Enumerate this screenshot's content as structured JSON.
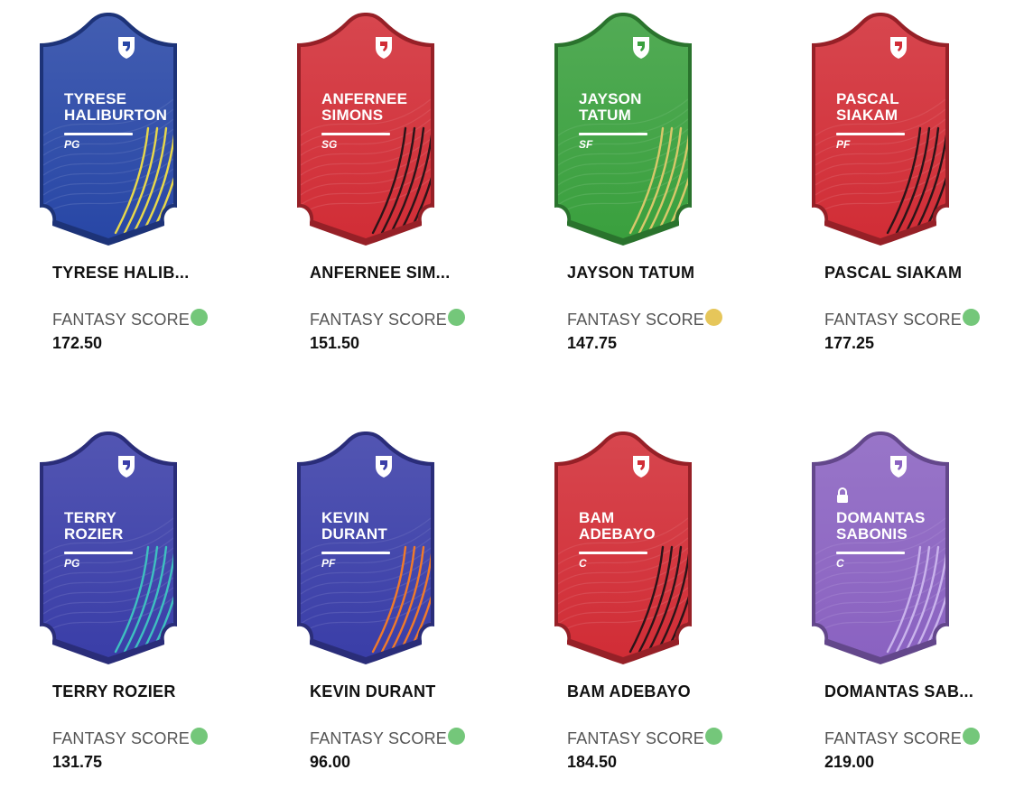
{
  "fantasy_label": "FANTASY SCORE",
  "colors": {
    "blue": "#2847a6",
    "red": "#d12d36",
    "green": "#3aa03e",
    "indigo": "#3a3ea8",
    "purple": "#8a62c1",
    "status_green": "#74c77a",
    "status_yellow": "#e6c65a"
  },
  "cards": [
    {
      "first": "TYRESE",
      "last": "HALIBURTON",
      "pos": "PG",
      "display_name": "TYRESE HALIB...",
      "score": "172.50",
      "theme": "blue",
      "stripes": "#e8d84a",
      "status": "green",
      "locked": false
    },
    {
      "first": "ANFERNEE",
      "last": "SIMONS",
      "pos": "SG",
      "display_name": "ANFERNEE SIM...",
      "score": "151.50",
      "theme": "red",
      "stripes": "#2a1418",
      "status": "green",
      "locked": false
    },
    {
      "first": "JAYSON",
      "last": "TATUM",
      "pos": "SF",
      "display_name": "JAYSON TATUM",
      "score": "147.75",
      "theme": "green",
      "stripes": "#d8c86a",
      "status": "yellow",
      "locked": false
    },
    {
      "first": "PASCAL",
      "last": "SIAKAM",
      "pos": "PF",
      "display_name": "PASCAL SIAKAM",
      "score": "177.25",
      "theme": "red",
      "stripes": "#2a1418",
      "status": "green",
      "locked": false
    },
    {
      "first": "TERRY",
      "last": "ROZIER",
      "pos": "PG",
      "display_name": "TERRY ROZIER",
      "score": "131.75",
      "theme": "indigo",
      "stripes": "#3ec0c0",
      "status": "green",
      "locked": false
    },
    {
      "first": "KEVIN",
      "last": "DURANT",
      "pos": "PF",
      "display_name": "KEVIN DURANT",
      "score": "96.00",
      "theme": "indigo",
      "stripes": "#f07a2a",
      "status": "green",
      "locked": false
    },
    {
      "first": "BAM",
      "last": "ADEBAYO",
      "pos": "C",
      "display_name": "BAM ADEBAYO",
      "score": "184.50",
      "theme": "red",
      "stripes": "#2a1418",
      "status": "green",
      "locked": false
    },
    {
      "first": "DOMANTAS",
      "last": "SABONIS",
      "pos": "C",
      "display_name": "DOMANTAS SAB...",
      "score": "219.00",
      "theme": "purple",
      "stripes": "#c9b3ec",
      "status": "green",
      "locked": true
    }
  ]
}
